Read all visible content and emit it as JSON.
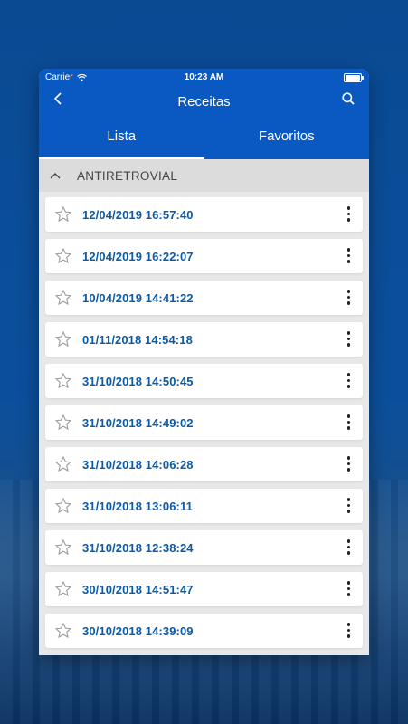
{
  "status_bar": {
    "carrier": "Carrier",
    "time": "10:23 AM"
  },
  "nav": {
    "title": "Receitas",
    "back_icon": "chevron-left-icon",
    "search_icon": "search-icon"
  },
  "tabs": [
    {
      "label": "Lista",
      "active": true
    },
    {
      "label": "Favoritos",
      "active": false
    }
  ],
  "section": {
    "title": "ANTIRETROVIAL",
    "expanded": true
  },
  "items": [
    {
      "date": "12/04/2019 16:57:40"
    },
    {
      "date": "12/04/2019 16:22:07"
    },
    {
      "date": "10/04/2019 14:41:22"
    },
    {
      "date": "01/11/2018 14:54:18"
    },
    {
      "date": "31/10/2018 14:50:45"
    },
    {
      "date": "31/10/2018 14:49:02"
    },
    {
      "date": "31/10/2018 14:06:28"
    },
    {
      "date": "31/10/2018 13:06:11"
    },
    {
      "date": "31/10/2018 12:38:24"
    },
    {
      "date": "30/10/2018 14:51:47"
    },
    {
      "date": "30/10/2018 14:39:09"
    }
  ],
  "colors": {
    "header_blue": "#0a58c2",
    "date_blue": "#0b5aa8"
  }
}
